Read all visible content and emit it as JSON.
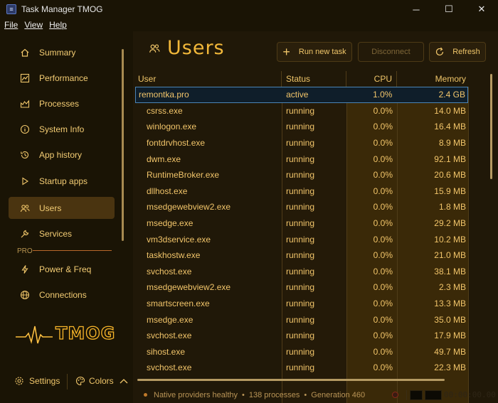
{
  "window": {
    "title": "Task Manager TMOG",
    "controls": [
      "─",
      "☐",
      "✕"
    ]
  },
  "menu": [
    "File",
    "View",
    "Help"
  ],
  "sidebar": {
    "items": [
      {
        "label": "Summary",
        "icon": "home-icon"
      },
      {
        "label": "Performance",
        "icon": "performance-icon"
      },
      {
        "label": "Processes",
        "icon": "processes-icon"
      },
      {
        "label": "System Info",
        "icon": "info-icon"
      },
      {
        "label": "App history",
        "icon": "history-icon"
      },
      {
        "label": "Startup apps",
        "icon": "startup-icon"
      },
      {
        "label": "Users",
        "icon": "users-icon",
        "active": true
      },
      {
        "label": "Services",
        "icon": "services-icon"
      }
    ],
    "pro_label": "PRO",
    "pro_items": [
      {
        "label": "Power & Freq",
        "icon": "power-icon"
      },
      {
        "label": "Connections",
        "icon": "globe-icon"
      }
    ],
    "logo_text": "TMOG",
    "settings_label": "Settings",
    "colors_label": "Colors"
  },
  "main": {
    "title": "Users",
    "buttons": {
      "run_new_task": "Run new task",
      "disconnect": "Disconnect",
      "refresh": "Refresh"
    },
    "table": {
      "headers": {
        "user": "User",
        "status": "Status",
        "cpu": "CPU",
        "memory": "Memory"
      },
      "rows": [
        {
          "user": "remontka.pro",
          "status": "active",
          "cpu": "1.0%",
          "memory": "2.4 GB",
          "parent": true
        },
        {
          "user": "csrss.exe",
          "status": "running",
          "cpu": "0.0%",
          "memory": "14.0 MB"
        },
        {
          "user": "winlogon.exe",
          "status": "running",
          "cpu": "0.0%",
          "memory": "16.4 MB"
        },
        {
          "user": "fontdrvhost.exe",
          "status": "running",
          "cpu": "0.0%",
          "memory": "8.9 MB"
        },
        {
          "user": "dwm.exe",
          "status": "running",
          "cpu": "0.0%",
          "memory": "92.1 MB"
        },
        {
          "user": "RuntimeBroker.exe",
          "status": "running",
          "cpu": "0.0%",
          "memory": "20.6 MB"
        },
        {
          "user": "dllhost.exe",
          "status": "running",
          "cpu": "0.0%",
          "memory": "15.9 MB"
        },
        {
          "user": "msedgewebview2.exe",
          "status": "running",
          "cpu": "0.0%",
          "memory": "1.8 MB"
        },
        {
          "user": "msedge.exe",
          "status": "running",
          "cpu": "0.0%",
          "memory": "29.2 MB"
        },
        {
          "user": "vm3dservice.exe",
          "status": "running",
          "cpu": "0.0%",
          "memory": "10.2 MB"
        },
        {
          "user": "taskhostw.exe",
          "status": "running",
          "cpu": "0.0%",
          "memory": "21.0 MB"
        },
        {
          "user": "svchost.exe",
          "status": "running",
          "cpu": "0.0%",
          "memory": "38.1 MB"
        },
        {
          "user": "msedgewebview2.exe",
          "status": "running",
          "cpu": "0.0%",
          "memory": "2.3 MB"
        },
        {
          "user": "smartscreen.exe",
          "status": "running",
          "cpu": "0.0%",
          "memory": "13.3 MB"
        },
        {
          "user": "msedge.exe",
          "status": "running",
          "cpu": "0.0%",
          "memory": "35.0 MB"
        },
        {
          "user": "svchost.exe",
          "status": "running",
          "cpu": "0.0%",
          "memory": "17.9 MB"
        },
        {
          "user": "sihost.exe",
          "status": "running",
          "cpu": "0.0%",
          "memory": "49.7 MB"
        },
        {
          "user": "svchost.exe",
          "status": "running",
          "cpu": "0.0%",
          "memory": "22.3 MB"
        }
      ]
    }
  },
  "statusbar": {
    "providers": "Native providers healthy",
    "processes": "138 processes",
    "generation": "Generation 460",
    "timer": "00:00:00.00"
  },
  "colors": {
    "accent": "#f2b83a",
    "active_nav": "#4a3410",
    "selected_row_border": "#4b84b6"
  }
}
